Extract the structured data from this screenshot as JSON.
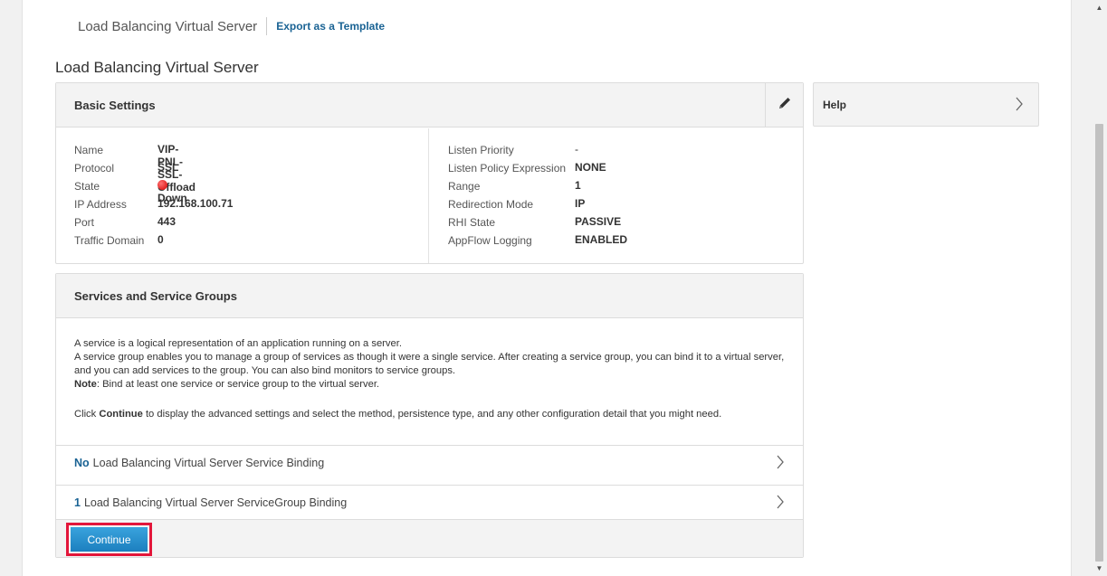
{
  "breadcrumb": {
    "title": "Load Balancing Virtual Server",
    "export_link": "Export as a Template"
  },
  "page_title": "Load Balancing Virtual Server",
  "basic_settings": {
    "header": "Basic Settings",
    "left": [
      {
        "label": "Name",
        "value": "VIP-PNL-SSL-Offload"
      },
      {
        "label": "Protocol",
        "value": "SSL"
      },
      {
        "label": "State",
        "value": "Down",
        "status_color": "#d40000"
      },
      {
        "label": "IP Address",
        "value": "192.168.100.71"
      },
      {
        "label": "Port",
        "value": "443"
      },
      {
        "label": "Traffic Domain",
        "value": "0"
      }
    ],
    "right": [
      {
        "label": "Listen Priority",
        "value": "-"
      },
      {
        "label": "Listen Policy Expression",
        "value": "NONE"
      },
      {
        "label": "Range",
        "value": "1"
      },
      {
        "label": "Redirection Mode",
        "value": "IP"
      },
      {
        "label": "RHI State",
        "value": "PASSIVE"
      },
      {
        "label": "AppFlow Logging",
        "value": "ENABLED"
      }
    ],
    "edit_icon": "pencil-icon"
  },
  "help": {
    "title": "Help",
    "icon": "chevron-right-icon"
  },
  "services": {
    "header": "Services and Service Groups",
    "line1": "A service is a logical representation of an application running on a server.",
    "line2": "A service group enables you to manage a group of services as though it were a single service. After creating a service group, you can bind it to a virtual server, and you can add services to the group. You can also bind monitors to service groups.",
    "note_label": "Note",
    "note_text": ": Bind at least one service or service group to the virtual server.",
    "click_pre": "Click ",
    "click_bold": "Continue",
    "click_post": " to display the advanced settings and select the method, persistence type, and any other configuration detail that you might need.",
    "bindings": [
      {
        "count": "No",
        "label": "Load Balancing Virtual Server Service Binding"
      },
      {
        "count": "1",
        "label": "Load Balancing Virtual Server ServiceGroup Binding"
      }
    ],
    "continue_label": "Continue"
  },
  "colors": {
    "link": "#1a6394",
    "accent_button": "#2a8fd0",
    "highlight_border": "#e3163a",
    "status_down": "#d40000"
  }
}
